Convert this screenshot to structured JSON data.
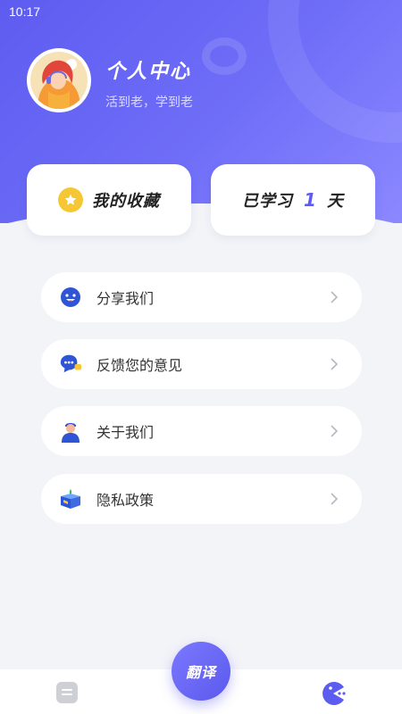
{
  "status_bar": {
    "time": "10:17"
  },
  "profile": {
    "title": "个人中心",
    "subtitle": "活到老，学到老",
    "avatar_icon": "girl-with-headphones-avatar"
  },
  "cards": {
    "favorites_label": "我的收藏",
    "favorites_icon": "star-icon",
    "learned_prefix": "已学习",
    "learned_days": "1",
    "learned_suffix": "天"
  },
  "menu": [
    {
      "label": "分享我们",
      "icon": "smiley-face-icon"
    },
    {
      "label": "反馈您的意见",
      "icon": "chat-bubble-icon"
    },
    {
      "label": "关于我们",
      "icon": "person-icon"
    },
    {
      "label": "隐私政策",
      "icon": "privacy-box-icon"
    }
  ],
  "tabbar": {
    "translate_label": "翻译",
    "left_icon": "document-icon",
    "right_icon": "pacman-icon"
  },
  "colors": {
    "accent": "#5d5cf0",
    "star": "#f6c735",
    "background": "#f3f4f8"
  }
}
